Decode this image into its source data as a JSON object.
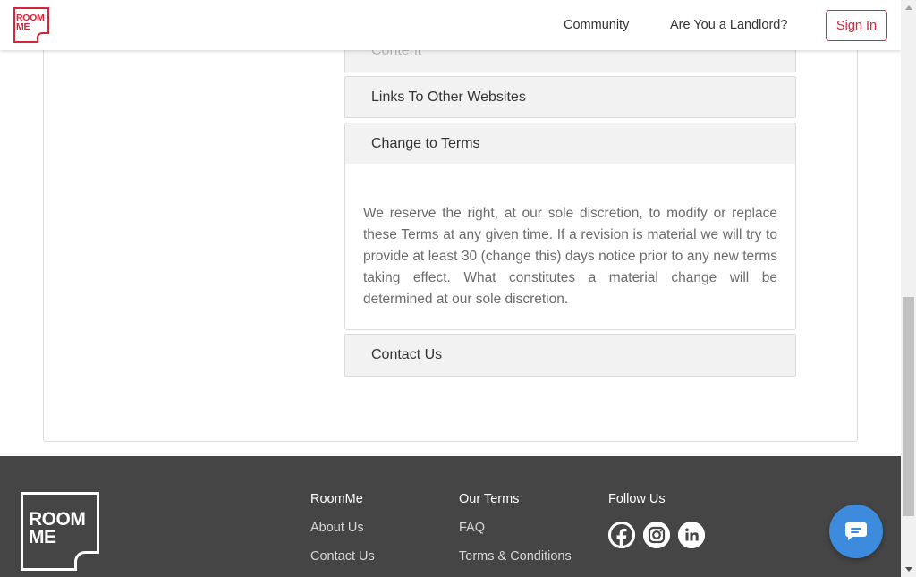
{
  "header": {
    "logo_text_line1": "ROOM",
    "logo_text_line2": "ME",
    "nav": {
      "community": "Community",
      "landlord": "Are You a Landlord?"
    },
    "sign_in": "Sign In"
  },
  "accordion": {
    "items": [
      {
        "label": "Content",
        "expanded": false
      },
      {
        "label": "Links To Other Websites",
        "expanded": false
      },
      {
        "label": "Change to Terms",
        "expanded": true
      },
      {
        "label": "Contact Us",
        "expanded": false
      }
    ],
    "expanded_text": "We reserve the right, at our sole discretion, to modify or replace these Terms at any given time. If a revision is material we will try to provide at least 30 (change this) days notice prior to any new terms taking effect. What constitutes a material change will be determined at our sole discretion."
  },
  "footer": {
    "logo_text_line1": "ROOM",
    "logo_text_line2": "ME",
    "columns": [
      {
        "heading": "RoomMe",
        "links": [
          "About Us",
          "Contact Us"
        ]
      },
      {
        "heading": "Our Terms",
        "links": [
          "FAQ",
          "Terms & Conditions"
        ]
      },
      {
        "heading": "Follow Us",
        "social": [
          "facebook-icon",
          "instagram-icon",
          "linkedin-icon"
        ]
      }
    ]
  },
  "colors": {
    "brand": "#d6243a",
    "footer_bg": "#454545",
    "chat_button": "#3d8bdc"
  }
}
